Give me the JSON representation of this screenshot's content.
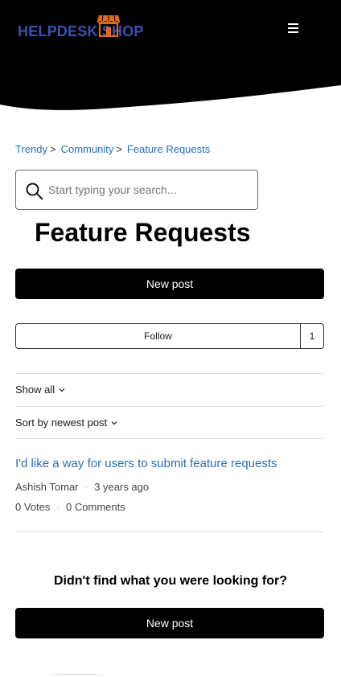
{
  "header": {
    "logo": {
      "text_part1": "HELPDESK S",
      "text_part2": "HOP",
      "icon": "storefront-icon",
      "color": "#3b4fb3",
      "icon_color": "#e06b1f"
    },
    "menu_icon": "hamburger-menu-icon"
  },
  "breadcrumb": {
    "items": [
      "Trendy",
      "Community",
      "Feature Requests"
    ],
    "separator": ">"
  },
  "search": {
    "placeholder": "Start typing your search...",
    "value": "",
    "icon": "search-icon"
  },
  "page": {
    "title": "Feature Requests"
  },
  "actions": {
    "new_post_label": "New post",
    "follow_label": "Follow",
    "follow_count": "1"
  },
  "filters": {
    "show_label": "Show all",
    "sort_label": "Sort by newest post"
  },
  "posts": [
    {
      "title": "I'd like a way for users to submit feature requests",
      "author": "Ashish Tomar",
      "age": "3 years ago",
      "votes": "0 Votes",
      "comments": "0 Comments"
    }
  ],
  "footer_prompt": {
    "text": "Didn't find what you were looking for?",
    "button_label": "New post"
  },
  "colors": {
    "link": "#2a6eb7",
    "primary_button": "#000000",
    "header_bg": "#000000"
  }
}
